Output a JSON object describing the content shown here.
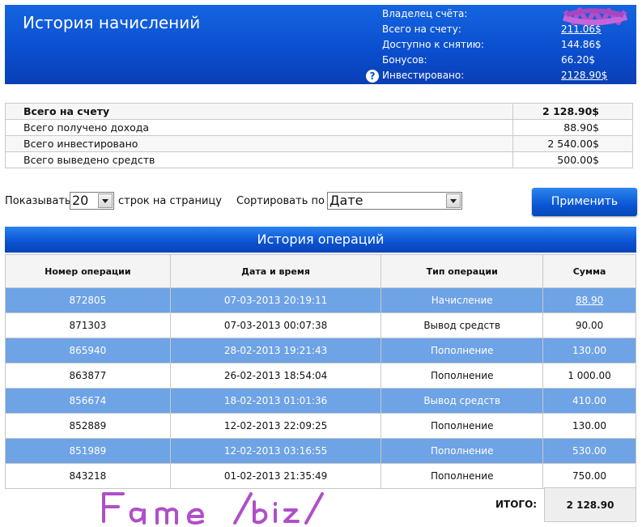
{
  "header": {
    "title": "История начислений",
    "account": [
      {
        "label": "Владелец счёта:",
        "value": "",
        "link": false
      },
      {
        "label": "Всего на счету:",
        "value": "211.06$",
        "link": true
      },
      {
        "label": "Доступно к снятию:",
        "value": "144.86$",
        "link": false
      },
      {
        "label": "Бонусов:",
        "value": "66.20$",
        "link": false
      },
      {
        "label": "Инвестировано:",
        "value": "2128.90$",
        "link": true
      }
    ],
    "help_icon": "?"
  },
  "summary": [
    {
      "label": "Всего на счету",
      "value": "2 128.90$"
    },
    {
      "label": "Всего получено дохода",
      "value": "88.90$"
    },
    {
      "label": "Всего инвестировано",
      "value": "2 540.00$"
    },
    {
      "label": "Всего выведено средств",
      "value": "500.00$"
    }
  ],
  "controls": {
    "show_label": "Показывать",
    "rows_value": "20",
    "rows_suffix": "строк на страницу",
    "sort_label": "Сортировать по",
    "sort_value": "Дате",
    "apply_label": "Применить"
  },
  "operations": {
    "title": "История операций",
    "columns": [
      "Номер операции",
      "Дата и время",
      "Тип операции",
      "Сумма"
    ],
    "rows": [
      {
        "id": "872805",
        "datetime": "07-03-2013 20:19:11",
        "type": "Начисление",
        "amount": "88.90",
        "highlight": true,
        "link": true
      },
      {
        "id": "871303",
        "datetime": "07-03-2013 00:07:38",
        "type": "Вывод средств",
        "amount": "90.00",
        "highlight": false,
        "link": false
      },
      {
        "id": "865940",
        "datetime": "28-02-2013 19:21:43",
        "type": "Пополнение",
        "amount": "130.00",
        "highlight": true,
        "link": false
      },
      {
        "id": "863877",
        "datetime": "26-02-2013 18:54:04",
        "type": "Пополнение",
        "amount": "1 000.00",
        "highlight": false,
        "link": false
      },
      {
        "id": "856674",
        "datetime": "18-02-2013 01:01:36",
        "type": "Вывод средств",
        "amount": "410.00",
        "highlight": true,
        "link": false
      },
      {
        "id": "852889",
        "datetime": "12-02-2013 22:09:25",
        "type": "Пополнение",
        "amount": "130.00",
        "highlight": false,
        "link": false
      },
      {
        "id": "851989",
        "datetime": "12-02-2013 03:16:55",
        "type": "Пополнение",
        "amount": "530.00",
        "highlight": true,
        "link": false
      },
      {
        "id": "843218",
        "datetime": "01-02-2013 21:35:49",
        "type": "Пополнение",
        "amount": "750.00",
        "highlight": false,
        "link": false
      }
    ],
    "total_label": "ИТОГО:",
    "total_value": "2 128.90"
  },
  "watermark": "Fame /biz/",
  "colors": {
    "header_blue": "#0b4fd0",
    "row_highlight": "#6ea3e6",
    "scribble": "#b04fc8"
  }
}
